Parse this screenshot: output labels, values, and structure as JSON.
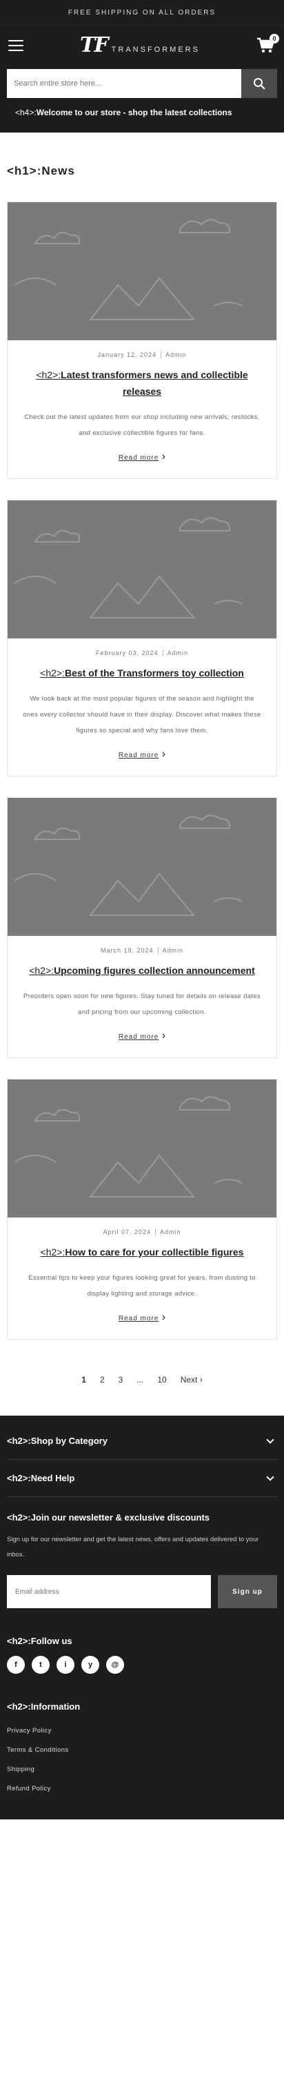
{
  "promo": {
    "text": "FREE SHIPPING ON ALL ORDERS"
  },
  "header": {
    "logo_mark": "TF",
    "logo_text": "TRANSFORMERS",
    "cart_count": "0"
  },
  "search": {
    "placeholder": "Search entire store here..."
  },
  "announcement": {
    "tag": "<h4>:",
    "text": "Welcome to our store - shop the latest collections"
  },
  "page": {
    "h1_tag": "<h1>:",
    "title": "News"
  },
  "articles": [
    {
      "date": "January 12, 2024",
      "author": "Admin",
      "tag": "<h2>:",
      "title": "Latest transformers news and collectible releases",
      "excerpt": "Check out the latest updates from our shop including new arrivals, restocks, and exclusive collectible figures for fans.",
      "read_more": "Read more"
    },
    {
      "date": "February 03, 2024",
      "author": "Admin",
      "tag": "<h2>:",
      "title": "Best of the Transformers toy collection",
      "excerpt": "We look back at the most popular figures of the season and highlight the ones every collector should have in their display. Discover what makes these figures so special and why fans love them.",
      "read_more": "Read more"
    },
    {
      "date": "March 19, 2024",
      "author": "Admin",
      "tag": "<h2>:",
      "title": "Upcoming figures collection announcement",
      "excerpt": "Preorders open soon for new figures. Stay tuned for details on release dates and pricing from our upcoming collection.",
      "read_more": "Read more"
    },
    {
      "date": "April 07, 2024",
      "author": "Admin",
      "tag": "<h2>:",
      "title": "How to care for your collectible figures",
      "excerpt": "Essential tips to keep your figures looking great for years, from dusting to display lighting and storage advice.",
      "read_more": "Read more"
    }
  ],
  "pagination": {
    "pages": [
      "1",
      "2",
      "3"
    ],
    "ellipsis": "...",
    "last": "10",
    "next": "Next"
  },
  "footer": {
    "accordion": [
      {
        "tag": "<h2>:",
        "label": "Shop by Category"
      },
      {
        "tag": "<h2>:",
        "label": "Need Help"
      }
    ],
    "newsletter": {
      "tag": "<h2>:",
      "title": "Join our newsletter & exclusive discounts",
      "text": "Sign up for our newsletter and get the latest news, offers and updates delivered to your inbox.",
      "placeholder": "Email address",
      "button": "Sign up"
    },
    "follow": {
      "tag": "<h2>:",
      "title": "Follow us",
      "icons": [
        "f",
        "t",
        "i",
        "y",
        "@"
      ]
    },
    "info": {
      "tag": "<h2>:",
      "title": "Information",
      "links": [
        "Privacy Policy",
        "Terms & Conditions",
        "Shipping",
        "Refund Policy"
      ]
    }
  }
}
